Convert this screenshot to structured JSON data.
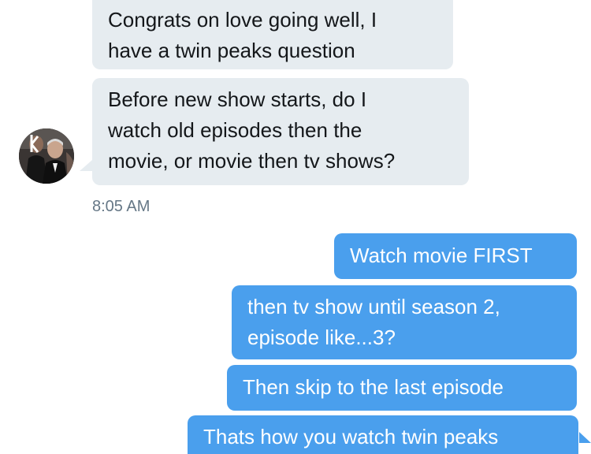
{
  "thread": {
    "incoming": [
      {
        "line1": "Congrats on love going well, I",
        "line2": "have a twin peaks question"
      },
      {
        "line1": "Before new show starts, do I",
        "line2": "watch old episodes then the",
        "line3": "movie, or movie then tv shows?"
      }
    ],
    "incoming_timestamp": "8:05 AM",
    "outgoing": [
      {
        "line1": "Watch movie FIRST"
      },
      {
        "line1": "then tv show until season 2,",
        "line2": "episode like...3?"
      },
      {
        "line1": "Then skip to the last episode"
      },
      {
        "line1": "Thats how you watch twin peaks"
      }
    ]
  },
  "colors": {
    "incoming_bubble": "#e6ecf0",
    "outgoing_bubble": "#4a9fed",
    "timestamp": "#657786"
  },
  "icons": {
    "avatar": "user-avatar-photo"
  }
}
